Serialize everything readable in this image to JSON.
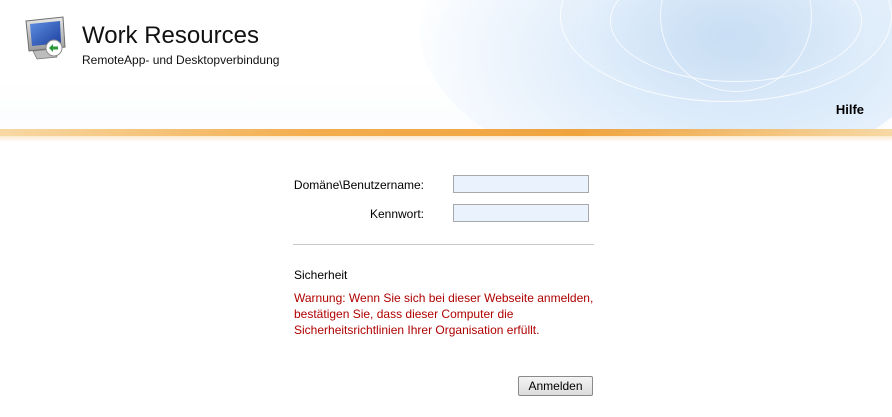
{
  "header": {
    "title": "Work Resources",
    "subtitle": "RemoteApp- und Desktopverbindung",
    "help_link": "Hilfe",
    "logo_icon": "remote-desktop-monitor-icon"
  },
  "login_form": {
    "username_label": "Domäne\\Benutzername:",
    "username_value": "",
    "password_label": "Kennwort:",
    "password_value": "",
    "security_title": "Sicherheit",
    "warning_text": "Warnung: Wenn Sie sich bei dieser Webseite anmelden, bestätigen Sie, dass dieser Computer die Sicherheitsrichtlinien Ihrer Organisation erfüllt.",
    "submit_label": "Anmelden"
  },
  "colors": {
    "accent_orange": "#ee9a2a",
    "warning_red": "#b00000",
    "field_background": "#eaf2fd"
  }
}
